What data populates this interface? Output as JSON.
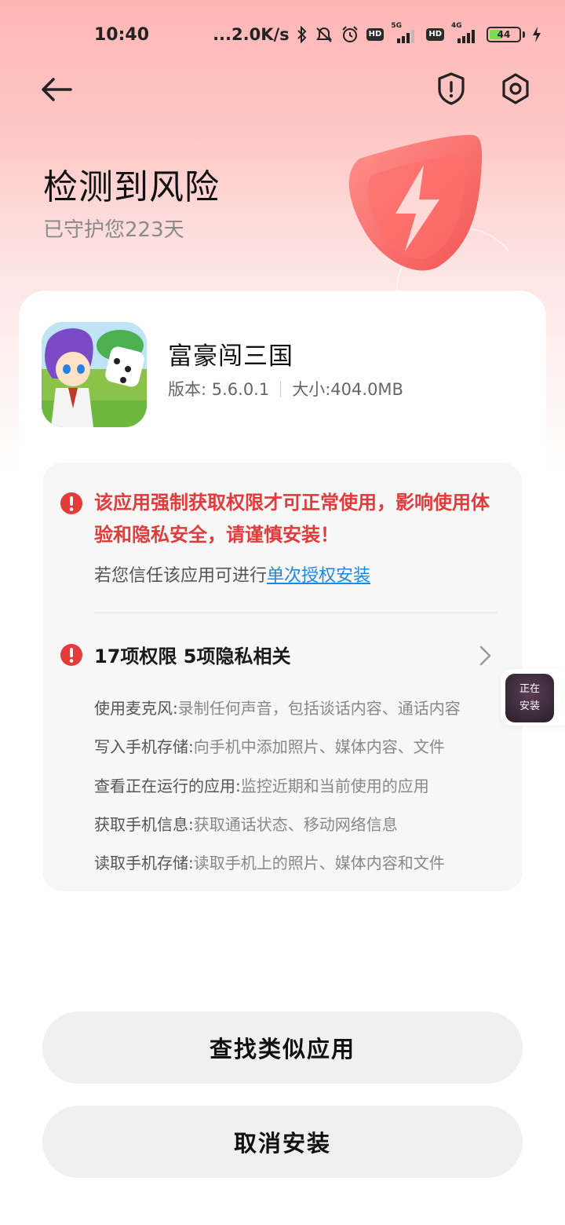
{
  "status_bar": {
    "time": "10:40",
    "net_speed": "...2.0K/s",
    "sim1_label": "5G",
    "sim2_label": "4G",
    "hd_label": "HD",
    "battery_level": "44",
    "battery_fraction": 0.44,
    "battery_color": "#7ed957"
  },
  "top_bar": {
    "back_icon": "arrow-left-icon",
    "shield_icon": "shield-alert-icon",
    "settings_icon": "gear-icon"
  },
  "header": {
    "title": "检测到风险",
    "subtitle": "已守护您223天"
  },
  "app": {
    "name": "富豪闯三国",
    "version": "版本: 5.6.0.1",
    "size": "大小:404.0MB"
  },
  "warning": {
    "text": "该应用强制获取权限才可正常使用，影响使用体验和隐私安全，请谨慎安装！",
    "trust_prefix": "若您信任该应用可进行",
    "trust_link": "单次授权安装",
    "accent_color": "#e53a3a",
    "link_color": "#1e88e5"
  },
  "permissions": {
    "summary": "17项权限  5项隐私相关",
    "items": [
      {
        "name": "使用麦克风:",
        "desc": " 录制任何声音，包括谈话内容、通话内容"
      },
      {
        "name": "写入手机存储:",
        "desc": " 向手机中添加照片、媒体内容、文件"
      },
      {
        "name": "查看正在运行的应用:",
        "desc": " 监控近期和当前使用的应用"
      },
      {
        "name": "获取手机信息:",
        "desc": " 获取通话状态、移动网络信息"
      },
      {
        "name": "读取手机存储:",
        "desc": " 读取手机上的照片、媒体内容和文件"
      }
    ]
  },
  "floating": {
    "line1": "正在",
    "line2": "安装"
  },
  "buttons": {
    "similar": "查找类似应用",
    "cancel": "取消安装"
  }
}
